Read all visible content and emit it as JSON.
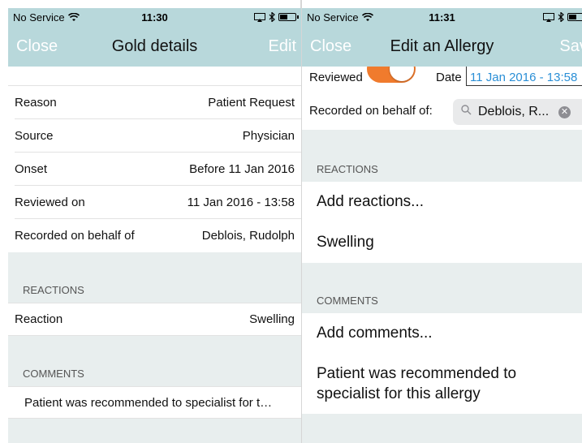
{
  "left": {
    "status": {
      "carrier": "No Service",
      "time": "11:30"
    },
    "nav": {
      "left": "Close",
      "title": "Gold details",
      "right": "Edit"
    },
    "rows": [
      {
        "label": "Reason",
        "value": "Patient Request"
      },
      {
        "label": "Source",
        "value": "Physician"
      },
      {
        "label": "Onset",
        "value": "Before 11 Jan 2016"
      },
      {
        "label": "Reviewed on",
        "value": "11 Jan 2016 - 13:58"
      },
      {
        "label": "Recorded on behalf of",
        "value": "Deblois, Rudolph"
      }
    ],
    "reactions_header": "REACTIONS",
    "reaction_row": {
      "label": "Reaction",
      "value": "Swelling"
    },
    "comments_header": "COMMENTS",
    "comment": "Patient was recommended to specialist for t…"
  },
  "right": {
    "status": {
      "carrier": "No Service",
      "time": "11:31"
    },
    "nav": {
      "left": "Close",
      "title": "Edit an Allergy",
      "right": "Save"
    },
    "reviewed_label": "Reviewed",
    "date_label": "Date",
    "date_value": "11 Jan 2016 - 13:58",
    "behalf_label": "Recorded on behalf of:",
    "behalf_value": "Deblois, R...",
    "reactions_header": "REACTIONS",
    "add_reactions": "Add reactions...",
    "reaction_item": "Swelling",
    "comments_header": "COMMENTS",
    "add_comments": "Add comments...",
    "comment": "Patient was recommended to specialist for this allergy"
  },
  "colors": {
    "bar": "#b8d8db",
    "accent": "#f07b2d",
    "link": "#2a8fd6",
    "section_bg": "#e8eeee"
  }
}
